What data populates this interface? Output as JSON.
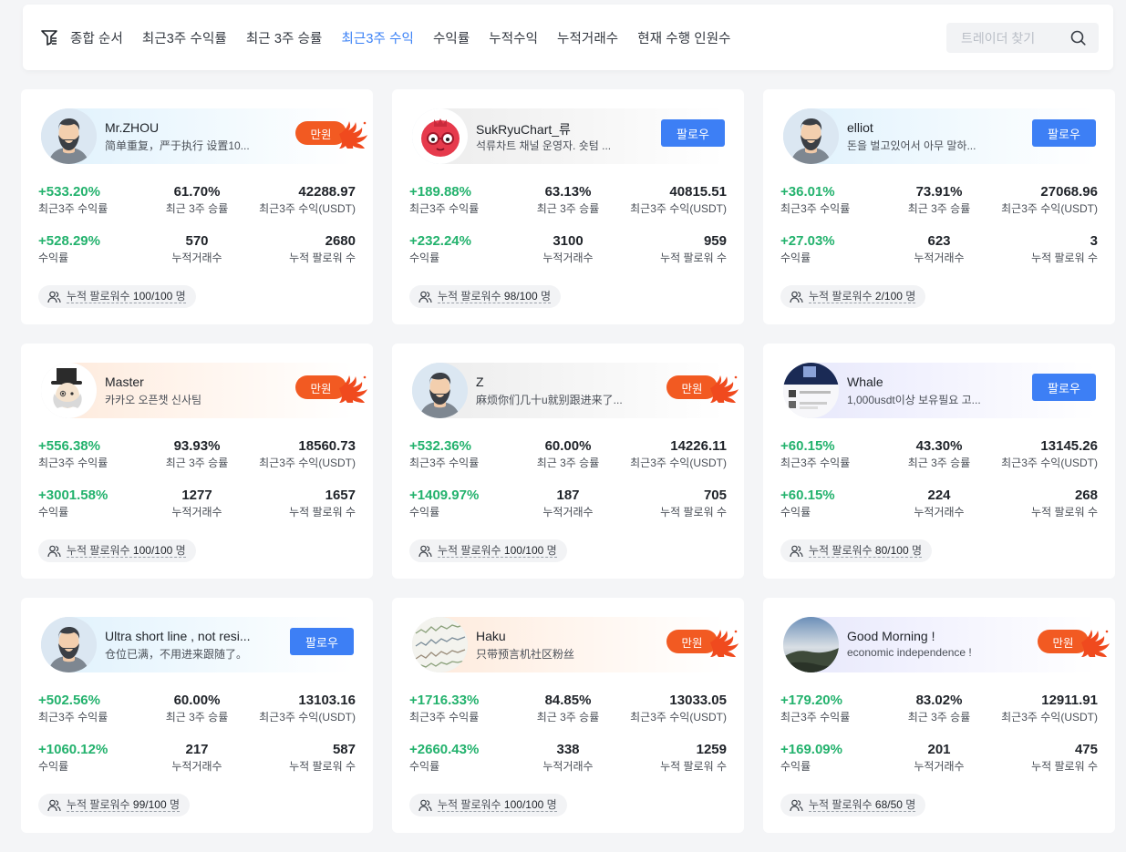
{
  "sort_tabs": [
    {
      "label": "종합 순서"
    },
    {
      "label": "최근3주 수익률"
    },
    {
      "label": "최근 3주 승률"
    },
    {
      "label": "최근3주 수익",
      "active": true
    },
    {
      "label": "수익률"
    },
    {
      "label": "누적수익"
    },
    {
      "label": "누적거래수"
    },
    {
      "label": "현재 수행 인원수"
    }
  ],
  "search": {
    "placeholder": "트레이더 찾기"
  },
  "labels": {
    "recent_roi": "최근3주 수익률",
    "recent_winrate": "최근 3주 승률",
    "recent_pnl": "최근3주 수익(USDT)",
    "roi": "수익률",
    "trades": "누적거래수",
    "followers": "누적 팔로워 수",
    "capacity_prefix": "누적 팔로워수",
    "capacity_suffix": "명",
    "follow_button": "팔로우",
    "full_badge": "만원"
  },
  "colors": {
    "accent": "#3d7ff5",
    "positive": "#23b26d",
    "full": "#f25a22"
  },
  "traders": [
    {
      "name": "Mr.ZHOU",
      "bio": "简单重复，严于执行 设置10...",
      "avatar": "bearded-man-avatar",
      "theme": "blue",
      "status": "full",
      "recent_roi": "+533.20%",
      "recent_winrate": "61.70%",
      "recent_pnl": "42288.97",
      "roi": "+528.29%",
      "trades": "570",
      "followers": "2680",
      "capacity": "100/100"
    },
    {
      "name": "SukRyuChart_류",
      "bio": "석류차트 채널 운영자. 숏텀 ...",
      "avatar": "pomegranate-avatar",
      "theme": "gray",
      "status": "follow",
      "recent_roi": "+189.88%",
      "recent_winrate": "63.13%",
      "recent_pnl": "40815.51",
      "roi": "+232.24%",
      "trades": "3100",
      "followers": "959",
      "capacity": "98/100"
    },
    {
      "name": "elliot",
      "bio": "돈을 벌고있어서 아무 말하...",
      "avatar": "bearded-man-avatar",
      "theme": "blue",
      "status": "follow",
      "recent_roi": "+36.01%",
      "recent_winrate": "73.91%",
      "recent_pnl": "27068.96",
      "roi": "+27.03%",
      "trades": "623",
      "followers": "3",
      "capacity": "2/100"
    },
    {
      "name": "Master",
      "bio": "카카오 오픈챗 신사팀",
      "avatar": "top-hat-gentleman-avatar",
      "theme": "orange",
      "status": "full",
      "recent_roi": "+556.38%",
      "recent_winrate": "93.93%",
      "recent_pnl": "18560.73",
      "roi": "+3001.58%",
      "trades": "1277",
      "followers": "1657",
      "capacity": "100/100"
    },
    {
      "name": "Z",
      "bio": "麻烦你们几十u就别跟进来了...",
      "avatar": "bearded-man-avatar",
      "theme": "gray",
      "status": "full",
      "recent_roi": "+532.36%",
      "recent_winrate": "60.00%",
      "recent_pnl": "14226.11",
      "roi": "+1409.97%",
      "trades": "187",
      "followers": "705",
      "capacity": "100/100"
    },
    {
      "name": "Whale",
      "bio": "1,000usdt이상 보유필요 고...",
      "avatar": "screenshot-avatar",
      "theme": "violet",
      "status": "follow",
      "recent_roi": "+60.15%",
      "recent_winrate": "43.30%",
      "recent_pnl": "13145.26",
      "roi": "+60.15%",
      "trades": "224",
      "followers": "268",
      "capacity": "80/100"
    },
    {
      "name": "Ultra short line , not resi...",
      "bio": "仓位已满，不用进来跟随了。",
      "avatar": "bearded-man-avatar",
      "theme": "blue",
      "status": "follow",
      "recent_roi": "+502.56%",
      "recent_winrate": "60.00%",
      "recent_pnl": "13103.16",
      "roi": "+1060.12%",
      "trades": "217",
      "followers": "587",
      "capacity": "99/100"
    },
    {
      "name": "Haku",
      "bio": "只带预言机社区粉丝",
      "avatar": "chart-grid-avatar",
      "theme": "orange",
      "status": "full",
      "recent_roi": "+1716.33%",
      "recent_winrate": "84.85%",
      "recent_pnl": "13033.05",
      "roi": "+2660.43%",
      "trades": "338",
      "followers": "1259",
      "capacity": "100/100"
    },
    {
      "name": "Good Morning !",
      "bio": "economic independence !",
      "avatar": "landscape-avatar",
      "theme": "violet",
      "status": "full",
      "recent_roi": "+179.20%",
      "recent_winrate": "83.02%",
      "recent_pnl": "12911.91",
      "roi": "+169.09%",
      "trades": "201",
      "followers": "475",
      "capacity": "68/50"
    }
  ]
}
